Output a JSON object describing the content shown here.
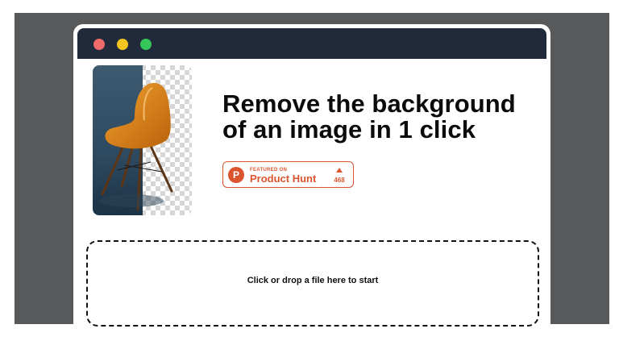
{
  "window": {
    "controls": [
      "close",
      "minimize",
      "maximize"
    ]
  },
  "hero": {
    "image_alt": "Orange chair with background partially removed",
    "headline_line1": "Remove the background",
    "headline_line2": "of an image in 1 click"
  },
  "product_hunt": {
    "featured_label": "FEATURED ON",
    "name": "Product Hunt",
    "logo_letter": "P",
    "upvotes": "468"
  },
  "dropzone": {
    "label": "Click or drop a file here to start"
  },
  "colors": {
    "frame_gray": "#58595b",
    "titlebar": "#202a3b",
    "product_hunt_accent": "#da552f"
  }
}
